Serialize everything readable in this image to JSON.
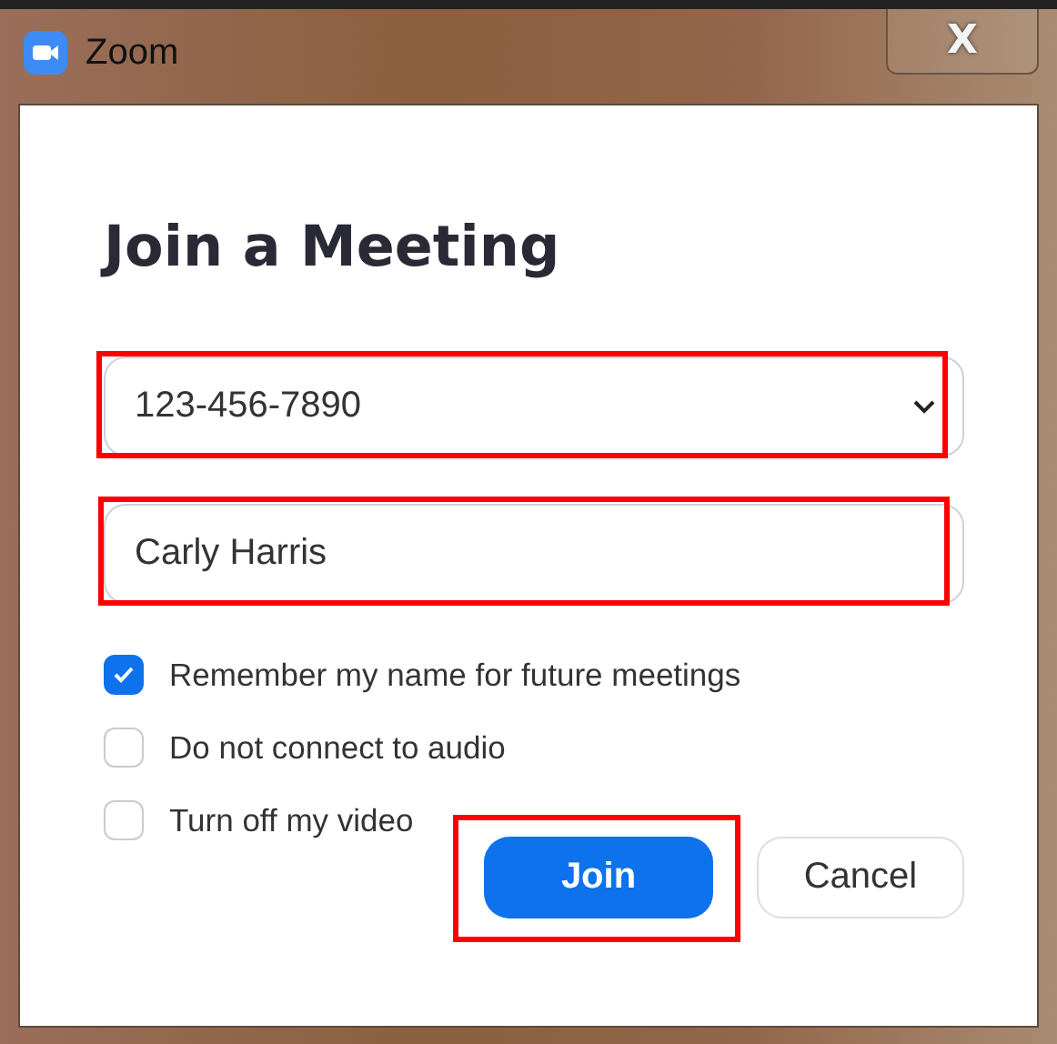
{
  "window": {
    "title": "Zoom",
    "close": "X"
  },
  "heading": "Join a Meeting",
  "meeting_id": {
    "value": "123-456-7890",
    "highlighted": true
  },
  "name": {
    "value": "Carly Harris",
    "highlighted": true
  },
  "options": [
    {
      "label": "Remember my name for future meetings",
      "checked": true
    },
    {
      "label": "Do not connect to audio",
      "checked": false
    },
    {
      "label": "Turn off my video",
      "checked": false
    }
  ],
  "buttons": [
    {
      "label": "Join",
      "kind": "primary",
      "highlighted": true
    },
    {
      "label": "Cancel",
      "kind": "secondary",
      "highlighted": false
    }
  ]
}
